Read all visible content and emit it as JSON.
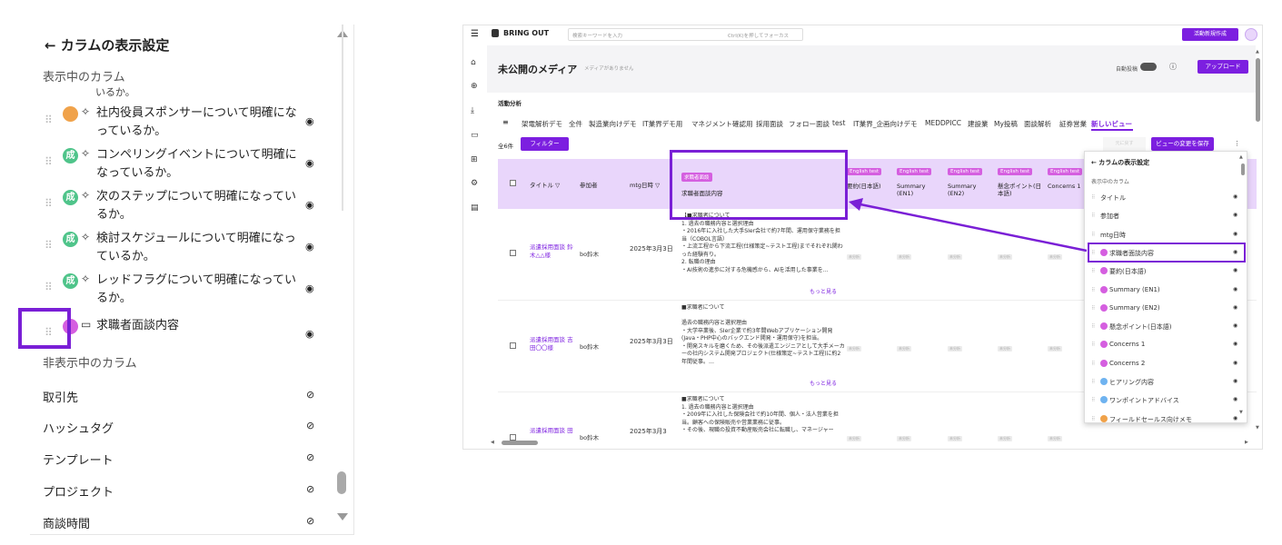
{
  "left_panel": {
    "title": "← カラムの表示設定",
    "visible_section": "表示中のカラム",
    "cut_text": "いるか。",
    "visible_items": [
      {
        "badge": "",
        "badge_color": "#f0a24a",
        "spark": "✧",
        "label": "社内役員スポンサーについて明確になっているか。"
      },
      {
        "badge": "成",
        "badge_color": "#4fc48a",
        "spark": "✧",
        "label": "コンペリングイベントについて明確になっているか。"
      },
      {
        "badge": "成",
        "badge_color": "#4fc48a",
        "spark": "✧",
        "label": "次のステップについて明確になっているか。"
      },
      {
        "badge": "成",
        "badge_color": "#4fc48a",
        "spark": "✧",
        "label": "検討スケジュールについて明確になっているか。"
      },
      {
        "badge": "成",
        "badge_color": "#4fc48a",
        "spark": "✧",
        "label": "レッドフラグについて明確になっているか。"
      }
    ],
    "highlighted_item": {
      "label": "求職者面談内容"
    },
    "hidden_section": "非表示中のカラム",
    "hidden_items": [
      "取引先",
      "ハッシュタグ",
      "テンプレート",
      "プロジェクト",
      "商談時間"
    ]
  },
  "app": {
    "logo": "BRING OUT",
    "search_placeholder": "検索キーワードを入力",
    "search_hint": "Ctrl(K)を押してフォーカス",
    "new_activity_button": "活動新規作成",
    "page_title": "未公開のメディア",
    "page_subtitle": "メディアがありません",
    "auto_post_label": "自動投稿",
    "upload_button": "アップロード",
    "section_label": "活動分析",
    "tabs": [
      "架電解析デモ",
      "全件",
      "製造業向けデモ",
      "IT業界デモ用",
      "マネジメント確認用",
      "採用面談",
      "フォロー面談",
      "test",
      "IT業界_企画向けデモ",
      "MEDDPICC",
      "建設業",
      "My投稿",
      "面談解析",
      "証券営業",
      "新しいビュー"
    ],
    "count_label": "全6件",
    "filter_button": "フィルター",
    "save_view_button": "ビューの変更を保存",
    "ghost_button": "元に戻す",
    "columns": {
      "title": "タイトル ▽",
      "participants": "参加者",
      "mtg_date": "mtg日時 ▽",
      "interview_chip": "求職者面談",
      "interview": "求職者面談内容",
      "english_chip": "English test",
      "summary_jp": "要約(日本語)",
      "summary_en1": "Summary (EN1)",
      "summary_en2": "Summary (EN2)",
      "concern_jp": "懸念ポイント(日本語)",
      "concerns1": "Concerns 1"
    },
    "placeholder_text": "未分析",
    "rows": [
      {
        "title": "派遣採用面談 鈴木△△様",
        "participant": "bo鈴木",
        "date": "2025年3月3日",
        "content": "【■求職者について\n1. 過去の職務内容と選択理由\n・2016年に入社した大手SIer会社で約7年間、運用保守業務を担当（COBOL言語）\n・上流工程から下流工程(仕様策定~テスト工程)までそれぞれ関わった経験有り。\n2. 転職の理由\n・AI技術の進歩に対する危機感から、AIを活用した事業を…"
      },
      {
        "title": "派遣採用面談 吉田〇〇様",
        "participant": "bo鈴木",
        "date": "2025年3月3日",
        "content": "■求職者について\n\n過去の職務内容と選択理由\n・大学卒業後、SIer企業で約3年間Webアプリケーション開発(Java・PHP中心のバックエンド開発・運用保守)を担当。\n・開発スキルを磨くため、その後派遣エンジニアとして大手メーカーの社内システム開発プロジェクト(仕様策定~テスト工程)に約2年間従事。…"
      },
      {
        "title": "派遣採用面談 田",
        "participant": "bo鈴木",
        "date": "2025年3月3",
        "content": "■求職者について\n1. 過去の職務内容と選択理由\n・2009年に入社した保険会社で約10年間、個人・法人営業を担当。顧客への保険販売や営業業務に従事。\n・その後、現職の投資不動産販売会社に転職し、マネージャー"
      }
    ],
    "more_link": "もっと見る",
    "popover": {
      "title": "← カラムの表示設定",
      "section": "表示中のカラム",
      "items": [
        {
          "label": "タイトル",
          "badge": ""
        },
        {
          "label": "参加者",
          "badge": ""
        },
        {
          "label": "mtg日時",
          "badge": ""
        },
        {
          "label": "求職者面談内容",
          "badge": "pink"
        },
        {
          "label": "要約(日本語)",
          "badge": "pink"
        },
        {
          "label": "Summary (EN1)",
          "badge": "pink"
        },
        {
          "label": "Summary (EN2)",
          "badge": "pink"
        },
        {
          "label": "懸念ポイント(日本語)",
          "badge": "pink"
        },
        {
          "label": "Concerns 1",
          "badge": "pink"
        },
        {
          "label": "Concerns 2",
          "badge": "pink"
        },
        {
          "label": "ヒアリング内容",
          "badge": "blue"
        },
        {
          "label": "ワンポイントアドバイス",
          "badge": "blue"
        },
        {
          "label": "フィールドセールス向けメモ",
          "badge": "orange"
        }
      ]
    }
  },
  "colors": {
    "accent": "#7c1fe0",
    "highlight": "#7a1fd6",
    "header_bg": "#e9d6fb",
    "pink": "#d55fe0",
    "blue": "#6fb3f0",
    "orange": "#f0a24a"
  }
}
